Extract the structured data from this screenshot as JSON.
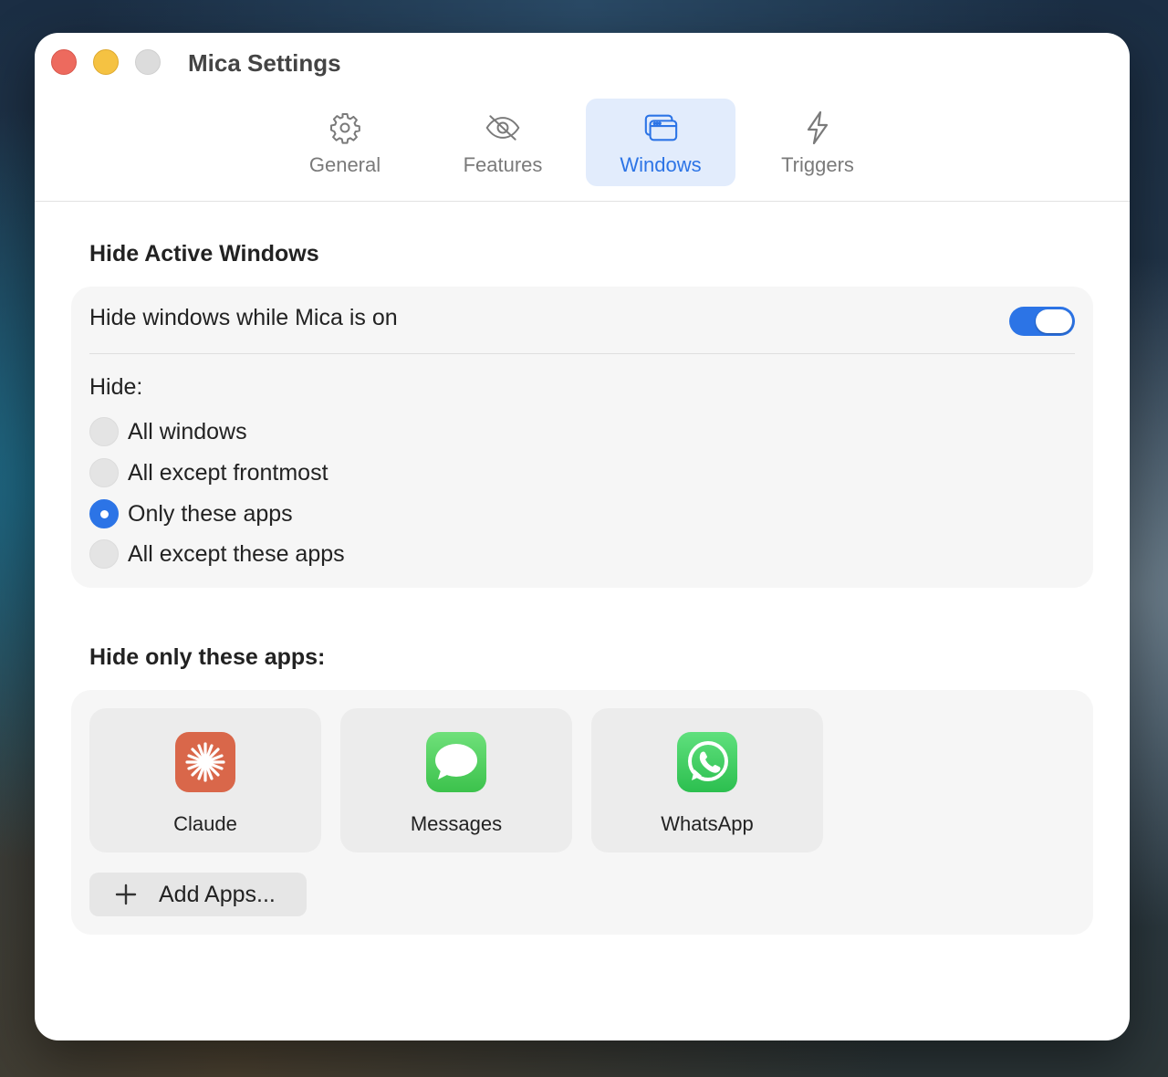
{
  "window": {
    "title": "Mica Settings"
  },
  "tabs": [
    {
      "label": "General",
      "icon": "gear-icon",
      "active": false
    },
    {
      "label": "Features",
      "icon": "eye-slash-icon",
      "active": false
    },
    {
      "label": "Windows",
      "icon": "windows-icon",
      "active": true
    },
    {
      "label": "Triggers",
      "icon": "bolt-icon",
      "active": false
    }
  ],
  "hide_active": {
    "title": "Hide Active Windows",
    "toggle_label": "Hide windows while Mica is on",
    "toggle_on": true,
    "hide_label": "Hide:",
    "options": [
      {
        "label": "All windows",
        "selected": false
      },
      {
        "label": "All except frontmost",
        "selected": false
      },
      {
        "label": "Only these apps",
        "selected": true
      },
      {
        "label": "All except these apps",
        "selected": false
      }
    ]
  },
  "apps_section": {
    "title": "Hide only these apps:",
    "apps": [
      {
        "name": "Claude",
        "icon": "claude-icon",
        "color": "#d9674a"
      },
      {
        "name": "Messages",
        "icon": "messages-icon",
        "color": "#4cd15d"
      },
      {
        "name": "WhatsApp",
        "icon": "whatsapp-icon",
        "color": "#33c75a"
      }
    ],
    "add_label": "Add Apps..."
  },
  "colors": {
    "accent": "#2c74e6",
    "close": "#ed6a5e",
    "minimize": "#f5c242"
  }
}
